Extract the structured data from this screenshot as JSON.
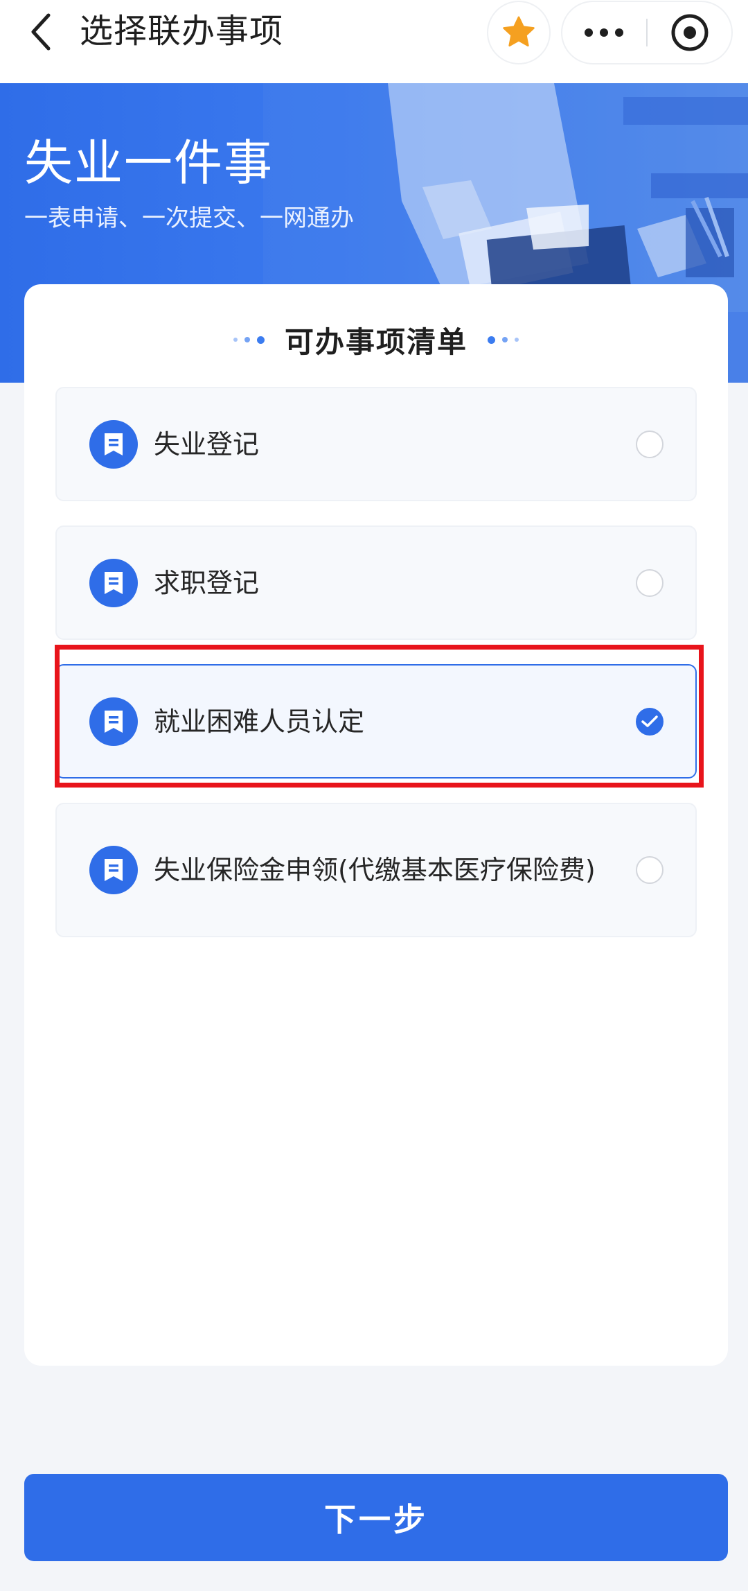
{
  "nav": {
    "title": "选择联办事项",
    "back_icon": "chevron-left-icon",
    "favorite_icon": "star-icon",
    "more_icon": "more-dots-icon",
    "close_icon": "target-circle-icon"
  },
  "hero": {
    "title": "失业一件事",
    "subtitle": "一表申请、一次提交、一网通办"
  },
  "card": {
    "title": "可办事项清单",
    "items": [
      {
        "label": "失业登记",
        "selected": false,
        "icon": "document-bookmark-icon"
      },
      {
        "label": "求职登记",
        "selected": false,
        "icon": "document-bookmark-icon"
      },
      {
        "label": "就业困难人员认定",
        "selected": true,
        "icon": "document-bookmark-icon"
      },
      {
        "label": "失业保险金申领(代缴基本医疗保险费)",
        "selected": false,
        "icon": "document-bookmark-icon"
      }
    ]
  },
  "footer": {
    "next_label": "下一步"
  },
  "colors": {
    "primary": "#2f6de8",
    "favorite": "#f5a020",
    "highlight": "#e8141b",
    "page_background": "#f3f5f9"
  }
}
